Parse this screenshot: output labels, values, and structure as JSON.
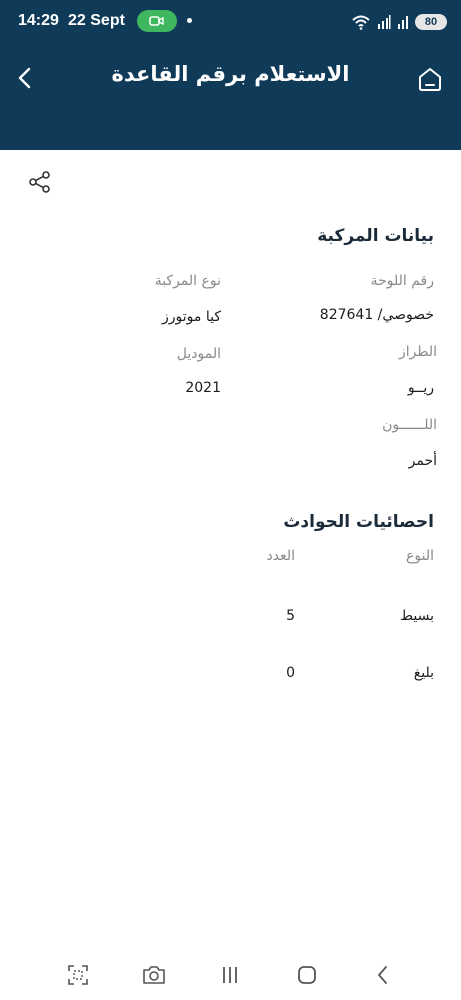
{
  "status_bar": {
    "time": "14:29",
    "date": "22 Sept",
    "battery": "80"
  },
  "header": {
    "title": "الاستعلام برقم القاعدة",
    "back_icon": "chevron-left-icon",
    "home_icon": "home-icon",
    "background": "#0f3b59"
  },
  "vehicle": {
    "section_title": "بيانات المركبة",
    "plate_label": "رقم اللوحة",
    "plate_value": "خصوصي/ 827641",
    "type_label": "نوع المركبة",
    "type_value": "كيا موتورز",
    "brand_label": "الطراز",
    "brand_value": "ريــو",
    "model_label": "الموديل",
    "model_value": "2021",
    "color_label": "اللــــــون",
    "color_value": "أحمر"
  },
  "accidents": {
    "section_title": "احصائيات الحوادث",
    "type_header": "النوع",
    "count_header": "العدد",
    "rows": [
      {
        "type": "بسيط",
        "count": "5"
      },
      {
        "type": "بليغ",
        "count": "0"
      }
    ]
  },
  "bottom_nav": {
    "icons": [
      "scan-icon",
      "camera-icon",
      "recent-apps-icon",
      "home-nav-icon",
      "back-nav-icon"
    ]
  }
}
